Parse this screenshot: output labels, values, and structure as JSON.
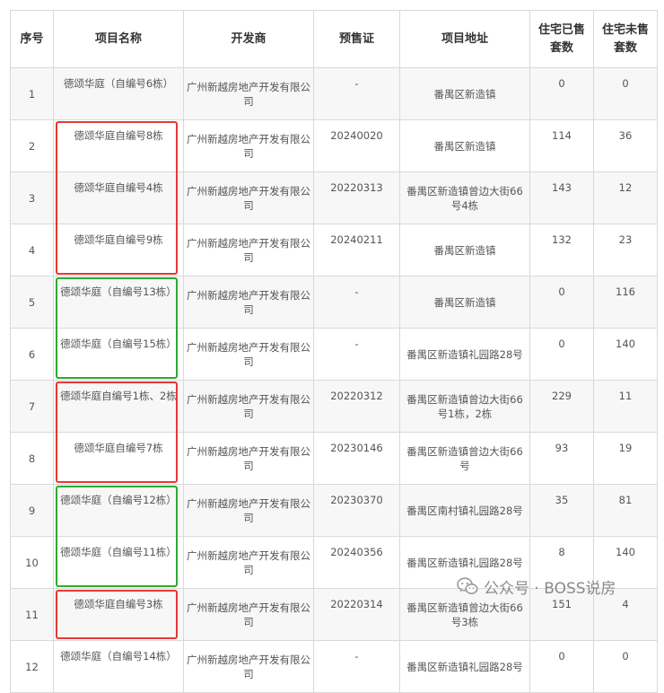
{
  "table": {
    "headers": [
      "序号",
      "项目名称",
      "开发商",
      "预售证",
      "项目地址",
      "住宅已售套数",
      "住宅未售套数"
    ],
    "rows": [
      [
        "1",
        "德颂华庭（自编号6栋）",
        "广州新越房地产开发有限公司",
        "-",
        "番禺区新造镇",
        "0",
        "0"
      ],
      [
        "2",
        "德颂华庭自编号8栋",
        "广州新越房地产开发有限公司",
        "20240020",
        "番禺区新造镇",
        "114",
        "36"
      ],
      [
        "3",
        "德颂华庭自编号4栋",
        "广州新越房地产开发有限公司",
        "20220313",
        "番禺区新造镇曾边大街66号4栋",
        "143",
        "12"
      ],
      [
        "4",
        "德颂华庭自编号9栋",
        "广州新越房地产开发有限公司",
        "20240211",
        "番禺区新造镇",
        "132",
        "23"
      ],
      [
        "5",
        "德颂华庭（自编号13栋）",
        "广州新越房地产开发有限公司",
        "-",
        "番禺区新造镇",
        "0",
        "116"
      ],
      [
        "6",
        "德颂华庭（自编号15栋）",
        "广州新越房地产开发有限公司",
        "-",
        "番禺区新造镇礼园路28号",
        "0",
        "140"
      ],
      [
        "7",
        "德颂华庭自编号1栋、2栋",
        "广州新越房地产开发有限公司",
        "20220312",
        "番禺区新造镇曾边大街66号1栋，2栋",
        "229",
        "11"
      ],
      [
        "8",
        "德颂华庭自编号7栋",
        "广州新越房地产开发有限公司",
        "20230146",
        "番禺区新造镇曾边大街66号",
        "93",
        "19"
      ],
      [
        "9",
        "德颂华庭（自编号12栋）",
        "广州新越房地产开发有限公司",
        "20230370",
        "番禺区南村镇礼园路28号",
        "35",
        "81"
      ],
      [
        "10",
        "德颂华庭（自编号11栋）",
        "广州新越房地产开发有限公司",
        "20240356",
        "番禺区新造镇礼园路28号",
        "8",
        "140"
      ],
      [
        "11",
        "德颂华庭自编号3栋",
        "广州新越房地产开发有限公司",
        "20220314",
        "番禺区新造镇曾边大街66号3栋",
        "151",
        "4"
      ],
      [
        "12",
        "德颂华庭（自编号14栋）",
        "广州新越房地产开发有限公司",
        "-",
        "番禺区新造镇礼园路28号",
        "0",
        "0"
      ]
    ]
  },
  "highlights": [
    {
      "color": "#e53935",
      "rows": [
        2,
        4
      ]
    },
    {
      "color": "#2eaa2e",
      "rows": [
        5,
        6
      ]
    },
    {
      "color": "#e53935",
      "rows": [
        7,
        8
      ]
    },
    {
      "color": "#2eaa2e",
      "rows": [
        9,
        10
      ]
    },
    {
      "color": "#e53935",
      "rows": [
        11,
        11
      ]
    }
  ],
  "watermark": {
    "icon": "wechat-icon",
    "text": "公众号 · BOSS说房"
  }
}
